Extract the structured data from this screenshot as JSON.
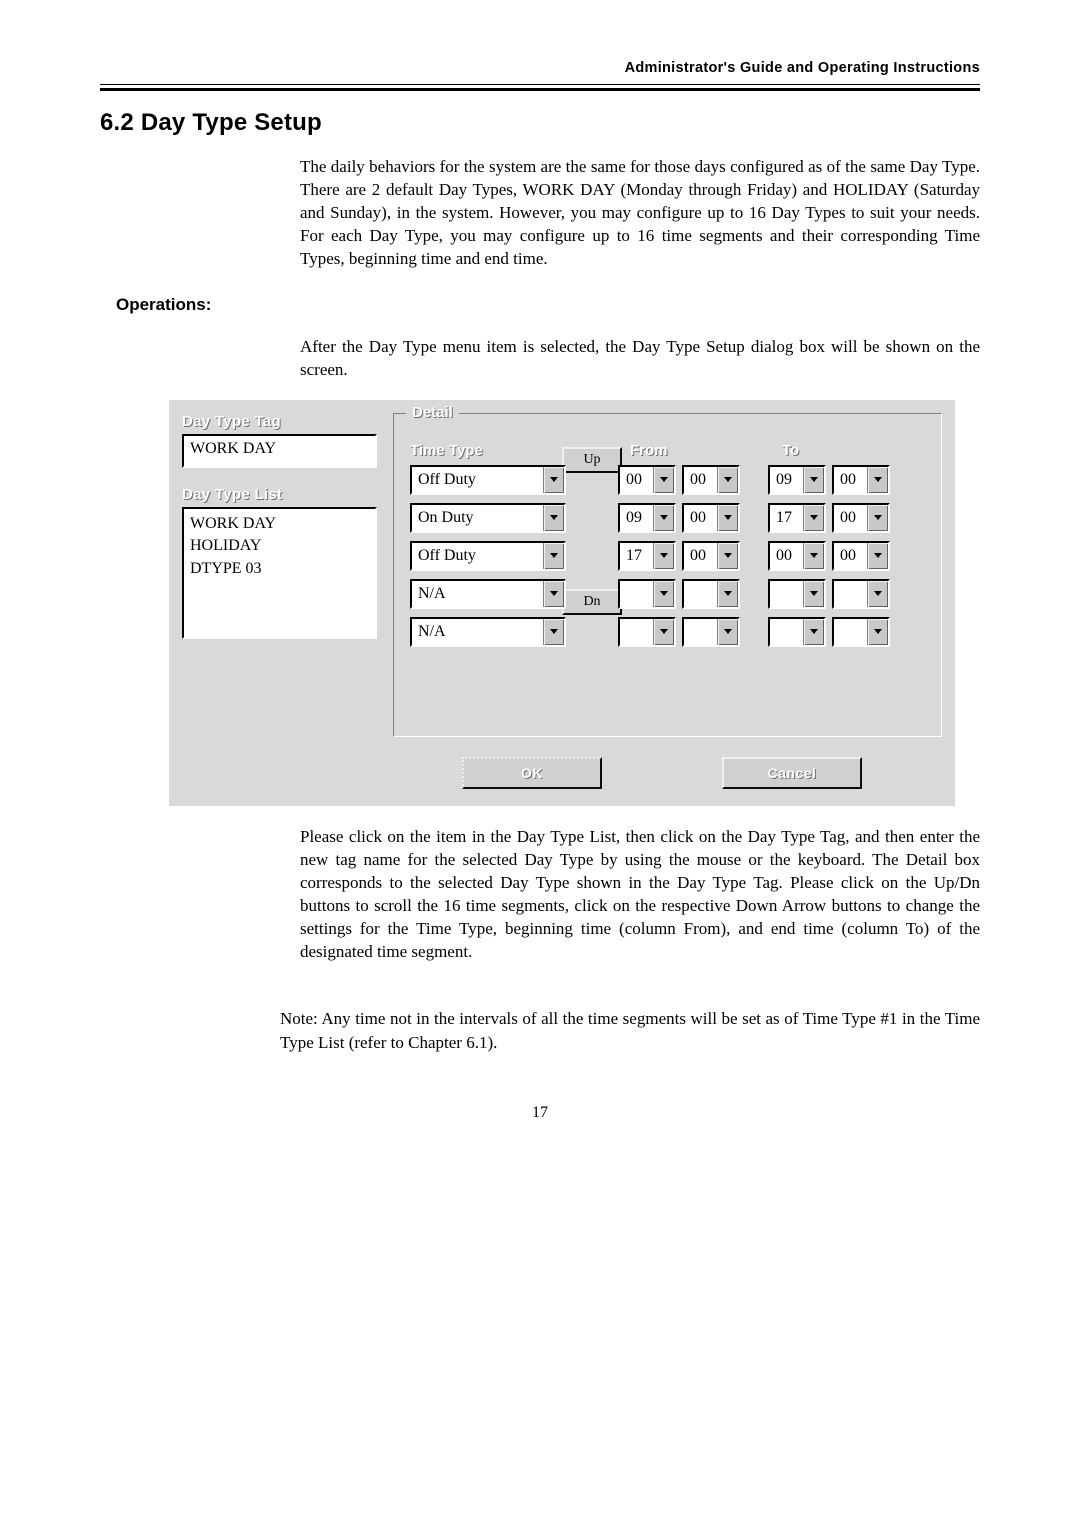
{
  "header": "Administrator's Guide and Operating Instructions",
  "section_title": "6.2 Day Type Setup",
  "para1": "The daily behaviors for the system are the same for those days configured as of the same Day Type.    There are 2 default Day Types, WORK DAY (Monday through Friday) and HOLIDAY (Saturday and Sunday), in the system.    However, you may configure up to 16 Day Types to suit your needs. For each Day Type, you may configure up to 16 time segments and their corresponding Time Types, beginning time and end time.",
  "operations_title": "Operations:",
  "para2": "After the Day Type menu item is selected, the Day Type Setup dialog box will be shown on the screen.",
  "dialog": {
    "labels": {
      "day_type_tag": "Day Type Tag",
      "day_type_list": "Day Type List",
      "detail": "Detail",
      "time_type": "Time Type",
      "from": "From",
      "to": "To",
      "up": "Up",
      "dn": "Dn",
      "ok": "OK",
      "cancel": "Cancel"
    },
    "day_type_tag_value": "WORK DAY",
    "list_items": [
      "WORK DAY",
      "HOLIDAY",
      "DTYPE 03"
    ],
    "rows": [
      {
        "time_type": "Off Duty",
        "from_h": "00",
        "from_m": "00",
        "to_h": "09",
        "to_m": "00"
      },
      {
        "time_type": "On Duty",
        "from_h": "09",
        "from_m": "00",
        "to_h": "17",
        "to_m": "00"
      },
      {
        "time_type": "Off Duty",
        "from_h": "17",
        "from_m": "00",
        "to_h": "00",
        "to_m": "00"
      },
      {
        "time_type": "N/A",
        "from_h": "",
        "from_m": "",
        "to_h": "",
        "to_m": ""
      },
      {
        "time_type": "N/A",
        "from_h": "",
        "from_m": "",
        "to_h": "",
        "to_m": ""
      }
    ]
  },
  "para3": "Please click on the item in the Day Type List, then click on the Day Type Tag, and then enter the new tag name for the selected Day Type by using the mouse or the keyboard.    The Detail box corresponds to the selected Day Type shown in the Day Type Tag.    Please click on the Up/Dn buttons to scroll the 16 time segments, click on the respective Down Arrow buttons to change the settings for the Time Type, beginning time (column From), and end time (column To) of the designated time segment.",
  "note": "Note: Any time not in the intervals of all the time segments will be set as of Time Type #1 in the Time Type List (refer to Chapter 6.1).",
  "page_number": "17"
}
